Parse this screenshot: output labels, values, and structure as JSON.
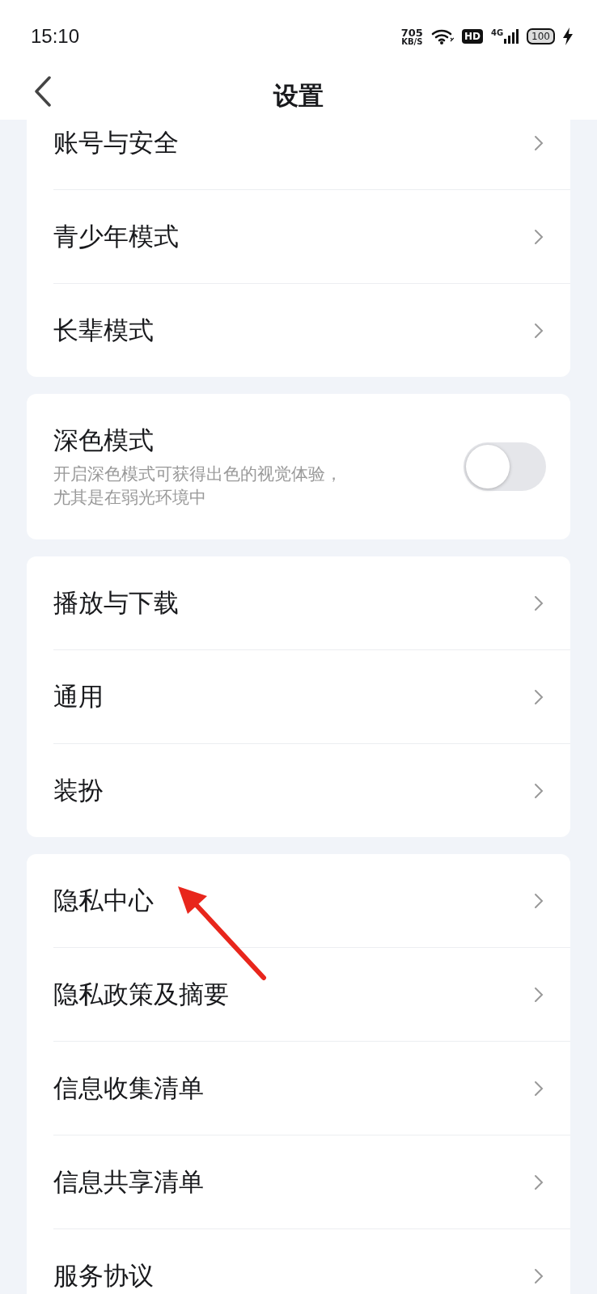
{
  "status_bar": {
    "time": "15:10",
    "speed": "705",
    "speed_unit": "KB/S",
    "hd": "HD",
    "network": "4G",
    "battery": "100"
  },
  "header": {
    "title": "设置"
  },
  "groups": [
    {
      "items": [
        {
          "kind": "link",
          "label": "账号与安全"
        },
        {
          "kind": "link",
          "label": "青少年模式"
        },
        {
          "kind": "link",
          "label": "长辈模式"
        }
      ]
    },
    {
      "items": [
        {
          "kind": "toggle",
          "label": "深色模式",
          "description": "开启深色模式可获得出色的视觉体验，尤其是在弱光环境中",
          "on": false
        }
      ]
    },
    {
      "items": [
        {
          "kind": "link",
          "label": "播放与下载"
        },
        {
          "kind": "link",
          "label": "通用"
        },
        {
          "kind": "link",
          "label": "装扮"
        }
      ]
    },
    {
      "items": [
        {
          "kind": "link",
          "label": "隐私中心"
        },
        {
          "kind": "link",
          "label": "隐私政策及摘要"
        },
        {
          "kind": "link",
          "label": "信息收集清单"
        },
        {
          "kind": "link",
          "label": "信息共享清单"
        },
        {
          "kind": "link",
          "label": "服务协议"
        }
      ]
    }
  ]
}
